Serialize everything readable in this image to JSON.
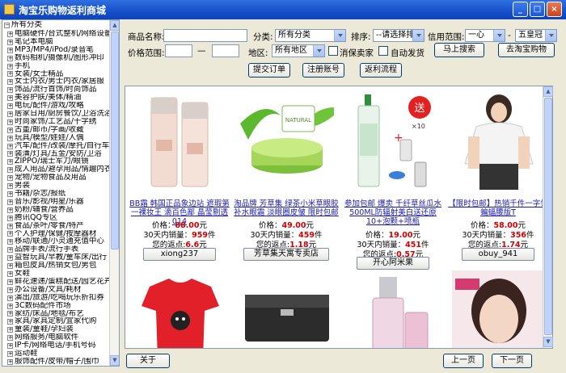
{
  "window": {
    "title": "淘宝乐购物返利商城"
  },
  "titlebar_buttons": [
    "_",
    "□",
    "×"
  ],
  "sidebar": {
    "root": "所有分类",
    "items": [
      "电脑硬件/台式整机/网络设备",
      "笔记本电脑",
      "MP3/MP4/iPod/录音笔",
      "数码相机/摄像机/图形冲印",
      "手机",
      "女装/女士精品",
      "女士内衣/男士内衣/家居服",
      "饰品/流行首饰/时尚饰品",
      "美容护肤/美体/精油",
      "电玩/配件/游戏/攻略",
      "居家日用/厨房餐饮/卫浴洗浴",
      "时尚家饰/工艺品/十字绣",
      "古董/邮币/字画/收藏",
      "玩具/模型/娃娃/人偶",
      "汽车/配件/改装/摩托/自行车",
      "装潢/灯具/五金/安防/卫浴",
      "ZIPPO/瑞士军刀/眼镜",
      "成人用品/避孕用品/情趣内衣",
      "宠物/宠物食品及用品",
      "男装",
      "书籍/杂志/报纸",
      "音乐/影视/明星/乐器",
      "奶粉/辅食/营养品",
      "腾讯QQ专区",
      "食品/茶叶/零食/特产",
      "个人护理/保健/按摩器材",
      "移动/联通/小灵通充值中心",
      "品牌手表/流行手表",
      "益智玩具/早教/童车床/出行",
      "箱包皮具/热销女包/男包",
      "女鞋",
      "鲜花速递/蛋糕配送/园艺花卉",
      "办公设备/文具/耗材",
      "演出/旅游/吃喝玩乐折扣券",
      "3C数码配件市场",
      "家纺/床品/地毯/布艺",
      "家具/家具定制/宜家代购",
      "童装/童鞋/孕妇装",
      "网络服务/电脑软件",
      "IP卡/网络电话/手机号码",
      "运动鞋",
      "服饰配件/皮带/帽子/围巾",
      "运动/瑜伽/健身/球迷用品"
    ]
  },
  "search": {
    "name_label": "商品名称:",
    "category_label": "分类:",
    "category_value": "所有分类",
    "sort_label": "排序:",
    "sort_value": "--请选择排序--",
    "credit_label": "信用范围:",
    "credit_from": "一心",
    "credit_sep": "-",
    "credit_to": "五皇冠",
    "price_label": "价格范围:",
    "price_sep": "—",
    "region_label": "地区:",
    "region_value": "所有地区",
    "consumer_label": "消保卖家",
    "auto_ship_label": "自动发货",
    "search_btn": "马上搜索",
    "taobao_btn": "去淘宝购物",
    "submit_order_btn": "提交订单",
    "register_btn": "注册账号",
    "rebate_flow_btn": "返利流程"
  },
  "products": [
    {
      "title": "BB霜 韩国正品象边站 遮瑕第一裸妆王 滴百色鄙 晶莹剔透 014",
      "price": "88.00",
      "sales": "959",
      "rebate": "6.6",
      "shop": "xiong237",
      "price_label": "价格：",
      "price_unit": "元",
      "sales_label": "30天内销量：",
      "sales_unit": "件",
      "rebate_label": "您的返点:",
      "rebate_unit": "元"
    },
    {
      "title": "淘品牌 芳草集 绿茶小米草眼胶 补水眼霜 淡眼圈皮皱 限时包邮",
      "price": "49.00",
      "sales": "459",
      "rebate": "1.18",
      "shop": "芳草集天寓专卖店",
      "price_label": "价格：",
      "price_unit": "元",
      "sales_label": "30天内销量：",
      "sales_unit": "件",
      "rebate_label": "您的返点:",
      "rebate_unit": "元"
    },
    {
      "title": "参加包邮 爆卖 千纤草丝瓜水 500ML防辐射美白送还原10+泡颗+喷瓶",
      "price": "19.00",
      "sales": "451",
      "rebate": "0.57",
      "shop": "开心阿米果",
      "price_label": "价格：",
      "price_unit": "元",
      "sales_label": "30天内销量：",
      "sales_unit": "件",
      "rebate_label": "您的返点:",
      "rebate_unit": "元"
    },
    {
      "title": "【限时包邮】热销千件一字领蝙蝠腰版T",
      "price": "58.00",
      "sales": "356",
      "rebate": "1.74",
      "shop": "obuy_941",
      "price_label": "价格：",
      "price_unit": "元",
      "sales_label": "30天内销量：",
      "sales_unit": "件",
      "rebate_label": "您的返点:",
      "rebate_unit": "元"
    }
  ],
  "footer": {
    "about_btn": "关于",
    "prev_btn": "上一页",
    "next_btn": "下一页"
  }
}
